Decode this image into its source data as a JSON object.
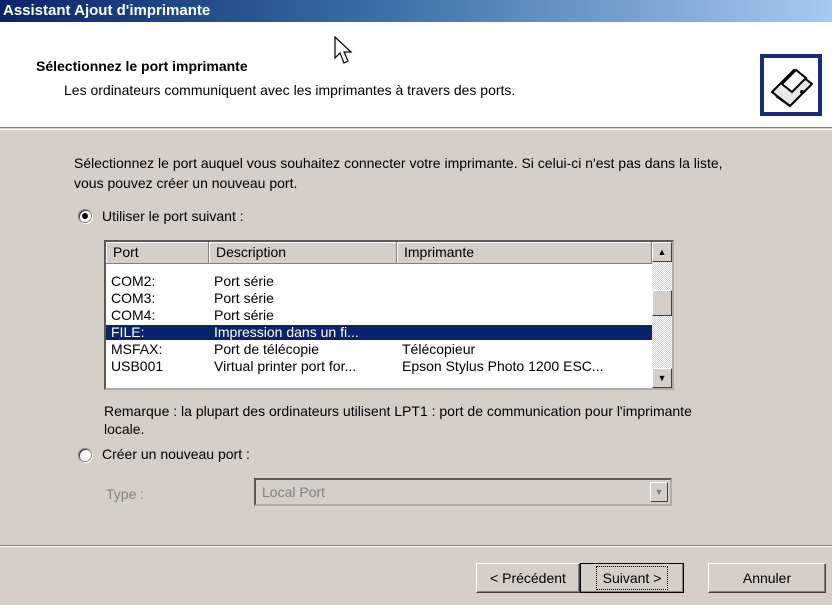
{
  "window": {
    "title": "Assistant Ajout d'imprimante"
  },
  "header": {
    "title": "Sélectionnez le port imprimante",
    "subtitle": "Les ordinateurs communiquent avec les imprimantes à travers des ports.",
    "icon": "printer-icon"
  },
  "intro": "Sélectionnez le port auquel vous souhaitez connecter votre imprimante. Si celui-ci n'est pas dans la liste, vous pouvez créer un nouveau port.",
  "option_existing": {
    "label": "Utiliser le port suivant :",
    "selected": true
  },
  "ports_table": {
    "headers": [
      "Port",
      "Description",
      "Imprimante"
    ],
    "rows": [
      {
        "port": "COM2:",
        "description": "Port série",
        "printer": ""
      },
      {
        "port": "COM3:",
        "description": "Port série",
        "printer": ""
      },
      {
        "port": "COM4:",
        "description": "Port série",
        "printer": ""
      },
      {
        "port": "FILE:",
        "description": "Impression dans un fi...",
        "printer": ""
      },
      {
        "port": "MSFAX:",
        "description": "Port de télécopie",
        "printer": "Télécopieur"
      },
      {
        "port": "USB001",
        "description": "Virtual printer port for...",
        "printer": "Epson Stylus Photo 1200 ESC..."
      }
    ],
    "selected_row": 3
  },
  "note": "Remarque : la plupart des ordinateurs utilisent LPT1 : port de communication pour l'imprimante locale.",
  "option_new": {
    "label": "Créer un nouveau port :",
    "selected": false,
    "type_label": "Type :",
    "type_value": "Local Port"
  },
  "buttons": {
    "back": "< Précédent",
    "next": "Suivant >",
    "cancel": "Annuler"
  }
}
